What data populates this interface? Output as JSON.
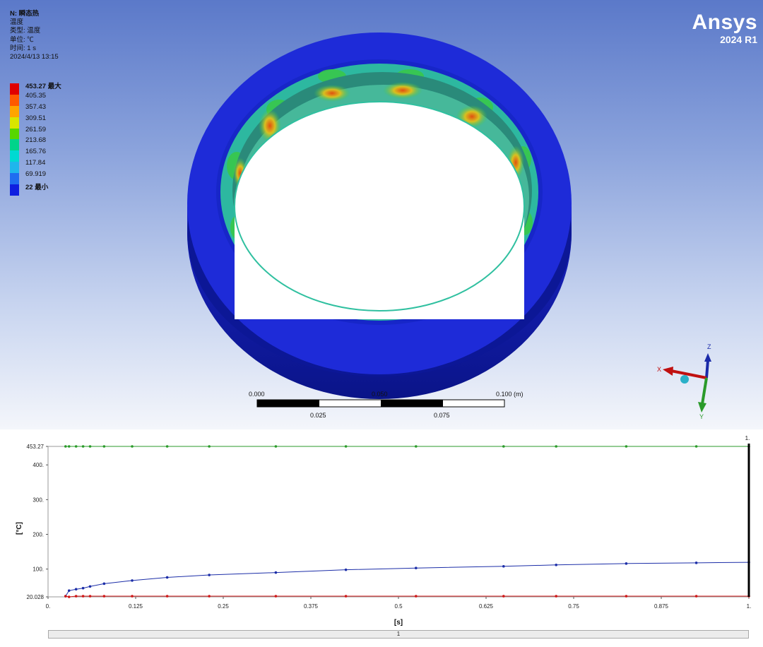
{
  "info": {
    "title": "N: 瞬态热",
    "type_name": "温度",
    "type_line": "类型: 温度",
    "unit_line": "单位: ℃",
    "time_line": "时间: 1 s",
    "date_line": "2024/4/13 13:15"
  },
  "legend": [
    {
      "label": "453.27 最大",
      "color": "#e00000",
      "strong": true
    },
    {
      "label": "405.35",
      "color": "#ff5a00",
      "strong": false
    },
    {
      "label": "357.43",
      "color": "#ffa500",
      "strong": false
    },
    {
      "label": "309.51",
      "color": "#d8e600",
      "strong": false
    },
    {
      "label": "261.59",
      "color": "#57d700",
      "strong": false
    },
    {
      "label": "213.68",
      "color": "#00d48a",
      "strong": false
    },
    {
      "label": "165.76",
      "color": "#00d9d2",
      "strong": false
    },
    {
      "label": "117.84",
      "color": "#1fb6ec",
      "strong": false
    },
    {
      "label": "69.919",
      "color": "#1f6df0",
      "strong": false
    },
    {
      "label": "22 最小",
      "color": "#0e1ee0",
      "strong": true
    }
  ],
  "logo": {
    "brand": "Ansys",
    "version": "2024 R1"
  },
  "scale_bar": {
    "top_labels": [
      "0.000",
      "0.050",
      "0.100 (m)"
    ],
    "bottom_labels": [
      "0.025",
      "0.075"
    ]
  },
  "triad": {
    "x": "X",
    "y": "Y",
    "z": "Z"
  },
  "chart_data": {
    "type": "line",
    "xlabel": "[s]",
    "ylabel": "[°C]",
    "xlim": [
      0,
      1
    ],
    "ylim": [
      20.028,
      453.27
    ],
    "x_ticks": [
      "0.",
      "0.125",
      "0.25",
      "0.375",
      "0.5",
      "0.625",
      "0.75",
      "0.875",
      "1."
    ],
    "y_ticks": [
      {
        "value": 20.028,
        "label": "20.028"
      },
      {
        "value": 100,
        "label": "100."
      },
      {
        "value": 200,
        "label": "200."
      },
      {
        "value": 300,
        "label": "300."
      },
      {
        "value": 400,
        "label": "400."
      },
      {
        "value": 453.27,
        "label": "453.27"
      }
    ],
    "marker_label": "1.",
    "marker_x": 1,
    "series": [
      {
        "color": "#2a9a2a",
        "x": [
          0.025,
          0.03,
          0.04,
          0.05,
          0.06,
          0.08,
          0.12,
          0.17,
          0.23,
          0.325,
          0.425,
          0.525,
          0.65,
          0.725,
          0.825,
          0.925,
          1.0
        ],
        "y": [
          453.27,
          453.27,
          453.27,
          453.27,
          453.27,
          453.27,
          453.27,
          453.27,
          453.27,
          453.27,
          453.27,
          453.27,
          453.27,
          453.27,
          453.27,
          453.27,
          453.27
        ]
      },
      {
        "color": "#1c2ea8",
        "x": [
          0.025,
          0.03,
          0.04,
          0.05,
          0.06,
          0.08,
          0.12,
          0.17,
          0.23,
          0.325,
          0.425,
          0.525,
          0.65,
          0.725,
          0.825,
          0.925,
          1.0
        ],
        "y": [
          22,
          38,
          42,
          45,
          50,
          58,
          67,
          76,
          83,
          90,
          98,
          103,
          108,
          112,
          116,
          118,
          119.5
        ]
      },
      {
        "color": "#d01818",
        "x": [
          0.025,
          0.03,
          0.04,
          0.05,
          0.06,
          0.08,
          0.12,
          0.17,
          0.23,
          0.325,
          0.425,
          0.525,
          0.65,
          0.725,
          0.825,
          0.925,
          1.0
        ],
        "y": [
          22,
          20.03,
          22,
          22,
          22,
          22,
          22,
          22,
          22,
          22,
          22,
          22,
          22,
          22,
          22,
          22,
          22
        ]
      }
    ]
  },
  "scrollbar": {
    "label": "1"
  }
}
